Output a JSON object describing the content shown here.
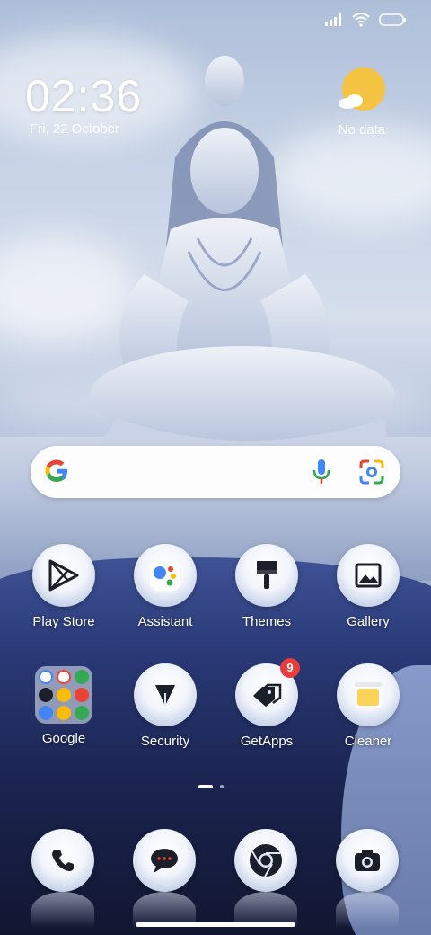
{
  "status_bar": {
    "icons": [
      "signal-icon",
      "wifi-icon",
      "battery-icon"
    ]
  },
  "clock": {
    "time": "02:36",
    "date": "Fri, 22 October"
  },
  "weather": {
    "text": "No data",
    "icon": "partly-sunny-icon"
  },
  "search": {
    "icons": [
      "google-logo-icon",
      "mic-icon",
      "lens-icon"
    ]
  },
  "apps_row1": [
    {
      "label": "Play Store",
      "icon": "play-store-icon"
    },
    {
      "label": "Assistant",
      "icon": "assistant-icon"
    },
    {
      "label": "Themes",
      "icon": "brush-icon"
    },
    {
      "label": "Gallery",
      "icon": "gallery-icon"
    }
  ],
  "apps_row2": [
    {
      "label": "Google",
      "icon": "folder-icon"
    },
    {
      "label": "Security",
      "icon": "security-icon"
    },
    {
      "label": "GetApps",
      "icon": "getapps-icon",
      "badge": "9"
    },
    {
      "label": "Cleaner",
      "icon": "cleaner-icon"
    }
  ],
  "dock": [
    {
      "icon": "phone-icon"
    },
    {
      "icon": "messages-icon"
    },
    {
      "icon": "chrome-icon"
    },
    {
      "icon": "camera-icon"
    }
  ]
}
